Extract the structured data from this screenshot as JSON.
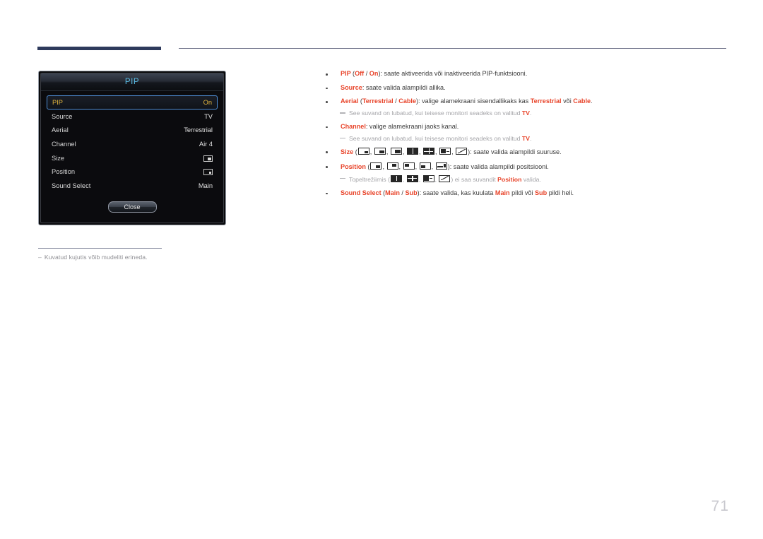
{
  "page": {
    "number": "71"
  },
  "osd": {
    "title": "PIP",
    "rows": [
      {
        "label": "PIP",
        "value": "On",
        "selected": true,
        "type": "text"
      },
      {
        "label": "Source",
        "value": "TV",
        "selected": false,
        "type": "text"
      },
      {
        "label": "Aerial",
        "value": "Terrestrial",
        "selected": false,
        "type": "text"
      },
      {
        "label": "Channel",
        "value": "Air 4",
        "selected": false,
        "type": "text"
      },
      {
        "label": "Size",
        "value": "",
        "selected": false,
        "type": "icon-size"
      },
      {
        "label": "Position",
        "value": "",
        "selected": false,
        "type": "icon-position"
      },
      {
        "label": "Sound Select",
        "value": "Main",
        "selected": false,
        "type": "text"
      }
    ],
    "close_label": "Close",
    "highlight_color": "#e0b33c",
    "title_color": "#5bbde6",
    "selection_border_color": "#4f8fd8"
  },
  "figure_note": {
    "dash": "–",
    "text": "Kuvatud kujutis võib mudeliti erineda."
  },
  "body": {
    "accent_color": "#e8442a",
    "items": [
      {
        "kind": "bullet",
        "id": "pip",
        "parts": [
          {
            "t": "PIP ",
            "s": "r"
          },
          {
            "t": "(",
            "s": "n"
          },
          {
            "t": "Off",
            "s": "r"
          },
          {
            "t": " / ",
            "s": "n"
          },
          {
            "t": "On",
            "s": "r"
          },
          {
            "t": "): saate aktiveerida või inaktiveerida PIP-funktsiooni.",
            "s": "n"
          }
        ]
      },
      {
        "kind": "bullet",
        "id": "source",
        "parts": [
          {
            "t": "Source",
            "s": "r"
          },
          {
            "t": ": saate valida alampildi allika.",
            "s": "n"
          }
        ]
      },
      {
        "kind": "bullet",
        "id": "aerial",
        "parts": [
          {
            "t": "Aerial ",
            "s": "r"
          },
          {
            "t": "(",
            "s": "n"
          },
          {
            "t": "Terrestrial",
            "s": "r"
          },
          {
            "t": " / ",
            "s": "n"
          },
          {
            "t": "Cable",
            "s": "r"
          },
          {
            "t": "): valige alamekraani sisendallikaks kas ",
            "s": "n"
          },
          {
            "t": "Terrestrial",
            "s": "r"
          },
          {
            "t": " või ",
            "s": "n"
          },
          {
            "t": "Cable",
            "s": "r"
          },
          {
            "t": ".",
            "s": "n"
          }
        ]
      },
      {
        "kind": "sub",
        "id": "aerial-note",
        "parts": [
          {
            "t": "See suvand on lubatud, kui teisese monitori seadeks on valitud ",
            "s": "n"
          },
          {
            "t": "TV",
            "s": "r"
          },
          {
            "t": ".",
            "s": "n"
          }
        ]
      },
      {
        "kind": "bullet",
        "id": "channel",
        "parts": [
          {
            "t": "Channel",
            "s": "r"
          },
          {
            "t": ": valige alamekraani jaoks kanal.",
            "s": "n"
          }
        ]
      },
      {
        "kind": "sub",
        "id": "channel-note",
        "parts": [
          {
            "t": "See suvand on lubatud, kui teisese monitori seadeks on valitud ",
            "s": "n"
          },
          {
            "t": "TV",
            "s": "r"
          },
          {
            "t": ".",
            "s": "n"
          }
        ]
      },
      {
        "kind": "bullet",
        "id": "size",
        "parts": [
          {
            "t": "Size ",
            "s": "r"
          },
          {
            "t": "(",
            "s": "n"
          },
          {
            "icon": "size-small"
          },
          {
            "t": ", ",
            "s": "n"
          },
          {
            "icon": "size-medium"
          },
          {
            "t": ", ",
            "s": "n"
          },
          {
            "icon": "size-large"
          },
          {
            "t": ", ",
            "s": "n"
          },
          {
            "icon": "double-vertical"
          },
          {
            "t": ", ",
            "s": "n"
          },
          {
            "icon": "double-quad"
          },
          {
            "t": ", ",
            "s": "n"
          },
          {
            "icon": "double-wide"
          },
          {
            "t": ", ",
            "s": "n"
          },
          {
            "icon": "double-diagonal"
          },
          {
            "t": "): saate valida alampildi suuruse.",
            "s": "n"
          }
        ]
      },
      {
        "kind": "bullet",
        "id": "position",
        "parts": [
          {
            "t": "Position ",
            "s": "r"
          },
          {
            "t": "(",
            "s": "n"
          },
          {
            "icon": "pos-bottom-right"
          },
          {
            "t": ", ",
            "s": "n"
          },
          {
            "icon": "pos-top-right"
          },
          {
            "t": ", ",
            "s": "n"
          },
          {
            "icon": "pos-top-left"
          },
          {
            "t": ", ",
            "s": "n"
          },
          {
            "icon": "pos-bottom-left"
          },
          {
            "t": ", ",
            "s": "n"
          },
          {
            "icon": "pos-custom"
          },
          {
            "t": "): saate valida alampildi positsiooni.",
            "s": "n"
          }
        ]
      },
      {
        "kind": "sub",
        "id": "position-note",
        "parts": [
          {
            "t": "Topeltrežiimis (",
            "s": "n"
          },
          {
            "icon": "double-vertical"
          },
          {
            "t": ", ",
            "s": "n"
          },
          {
            "icon": "double-quad"
          },
          {
            "t": ", ",
            "s": "n"
          },
          {
            "icon": "double-wide"
          },
          {
            "t": ", ",
            "s": "n"
          },
          {
            "icon": "double-diagonal"
          },
          {
            "t": ") ei saa suvandit ",
            "s": "n"
          },
          {
            "t": "Position",
            "s": "r"
          },
          {
            "t": " valida.",
            "s": "n"
          }
        ]
      },
      {
        "kind": "bullet",
        "id": "sound-select",
        "parts": [
          {
            "t": "Sound Select ",
            "s": "r"
          },
          {
            "t": "(",
            "s": "n"
          },
          {
            "t": "Main",
            "s": "r"
          },
          {
            "t": " / ",
            "s": "n"
          },
          {
            "t": "Sub",
            "s": "r"
          },
          {
            "t": "): saate valida, kas kuulata ",
            "s": "n"
          },
          {
            "t": "Main",
            "s": "r"
          },
          {
            "t": " pildi või ",
            "s": "n"
          },
          {
            "t": "Sub",
            "s": "r"
          },
          {
            "t": " pildi heli.",
            "s": "n"
          }
        ]
      }
    ]
  }
}
